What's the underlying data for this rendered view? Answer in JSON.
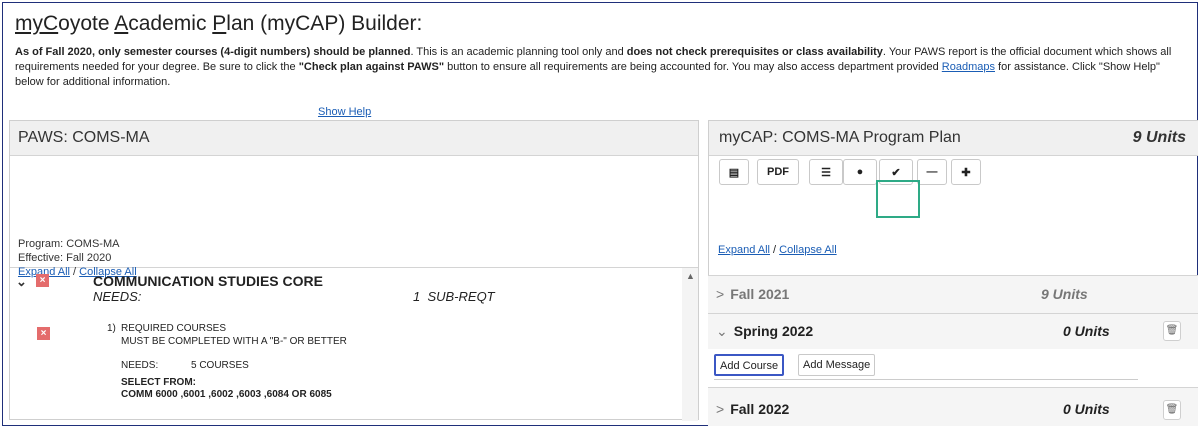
{
  "header": {
    "title_parts": [
      "my",
      "C",
      "oyote ",
      "A",
      "cademic ",
      "P",
      "lan (myCAP) Builder:"
    ],
    "intro": {
      "b1": "As of Fall 2020, only semester courses (4-digit numbers) should be planned",
      "t1": ". This is an academic planning tool only and ",
      "b2": "does not check prerequisites or class availability",
      "t2": ". Your PAWS report is the official document which shows all requirements needed for your degree. Be sure to click the ",
      "b3": "\"Check plan against PAWS\"",
      "t3": " button to ensure all requirements are being accounted for. You may also access department provided ",
      "link": "Roadmaps",
      "t4": " for assistance. Click \"Show Help\" below for additional information."
    },
    "show_help": "Show Help"
  },
  "left_panel": {
    "title": "PAWS: COMS-MA",
    "program": "Program: COMS-MA",
    "effective": "Effective: Fall 2020",
    "expand_all": "Expand All",
    "separator": " / ",
    "collapse_all": "Collapse All",
    "requirement": {
      "title": "COMMUNICATION STUDIES CORE",
      "needs_label": "NEEDS:",
      "needs_value": "1  SUB-REQT",
      "sub": {
        "number": "1)",
        "line1": "REQUIRED COURSES",
        "line2": "MUST BE COMPLETED WITH A \"B-\" OR BETTER",
        "needs_label": "NEEDS:",
        "needs_value": "5 COURSES",
        "select_from": "SELECT FROM:",
        "courses": "COMM 6000 ,6001 ,6002 ,6003 ,6084 OR 6085"
      }
    }
  },
  "right_panel": {
    "title": "myCAP: COMS-MA Program Plan",
    "units": "9 Units",
    "toolbar": {
      "pdf": "PDF"
    },
    "expand_all": "Expand All",
    "separator": " / ",
    "collapse_all": "Collapse All",
    "terms": [
      {
        "name": "Fall 2021",
        "units": "9 Units"
      },
      {
        "name": "Spring 2022",
        "units": "0 Units"
      },
      {
        "name": "Fall 2022",
        "units": "0 Units"
      }
    ],
    "add_course": "Add Course",
    "add_message": "Add Message"
  }
}
